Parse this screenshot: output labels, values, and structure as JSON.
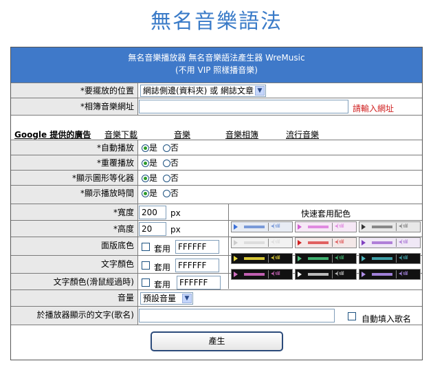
{
  "page_title": "無名音樂語法",
  "header": {
    "line1": "無名音樂播放器 無名音樂語法產生器 WreMusic",
    "line2": "(不用 VIP 照樣播音樂)"
  },
  "position": {
    "label": "*要擺放的位置",
    "selected": "網誌側邊(資料夾) 或 網誌文章"
  },
  "album_url": {
    "label": "*相簿音樂網址",
    "value": "",
    "hint": "請輸入網址"
  },
  "ads": {
    "title": "Google 提供的廣告",
    "links": [
      "音樂下載",
      "音樂",
      "音樂相簿",
      "流行音樂"
    ]
  },
  "autoplay": {
    "label": "*自動播放",
    "yes": "是",
    "no": "否"
  },
  "repeat": {
    "label": "*重覆播放",
    "yes": "是",
    "no": "否"
  },
  "equalizer": {
    "label": "*顯示圖形等化器",
    "yes": "是",
    "no": "否"
  },
  "show_time": {
    "label": "*顯示播放時間",
    "yes": "是",
    "no": "否"
  },
  "width": {
    "label": "*寬度",
    "value": "200",
    "unit": "px"
  },
  "height": {
    "label": "*高度",
    "value": "20",
    "unit": "px"
  },
  "panel_bg": {
    "label": "面版底色",
    "apply": "套用",
    "value": "FFFFFF"
  },
  "text_color": {
    "label": "文字顏色",
    "apply": "套用",
    "value": "FFFFFF"
  },
  "hover_text_color": {
    "label": "文字顏色(滑鼠經過時)",
    "apply": "套用",
    "value": "FFFFFF"
  },
  "quick_colors": {
    "title": "快速套用配色",
    "schemes": [
      {
        "bg": "#e8ecf4",
        "bar": "#7a9ad8",
        "play": "#3a6fd8"
      },
      {
        "bg": "#f6e8f6",
        "bar": "#e08ae0",
        "play": "#d060d0"
      },
      {
        "bg": "#e8e8e8",
        "bar": "#888888",
        "play": "#333333"
      },
      {
        "bg": "#f2f2f2",
        "bar": "#dddddd",
        "play": "#cccccc"
      },
      {
        "bg": "#f4e8e8",
        "bar": "#e06060",
        "play": "#d02020"
      },
      {
        "bg": "#f0e8f6",
        "bar": "#b080d8",
        "play": "#8040c0"
      },
      {
        "bg": "#111111",
        "bar": "#d8c838",
        "play": "#e8d840"
      },
      {
        "bg": "#111111",
        "bar": "#40b070",
        "play": "#50c080"
      },
      {
        "bg": "#111111",
        "bar": "#40a0a8",
        "play": "#50b8c0"
      },
      {
        "bg": "#111111",
        "bar": "#c060b0",
        "play": "#d070c0"
      },
      {
        "bg": "#111111",
        "bar": "#bbbbbb",
        "play": "#ffffff"
      },
      {
        "bg": "#111111",
        "bar": "#a080d8",
        "play": "#b090e8"
      }
    ]
  },
  "volume": {
    "label": "音量",
    "selected": "預設音量"
  },
  "song_title": {
    "label": "於播放器顯示的文字(歌名)",
    "value": "",
    "auto_label": "自動填入歌名"
  },
  "generate_label": "產生"
}
